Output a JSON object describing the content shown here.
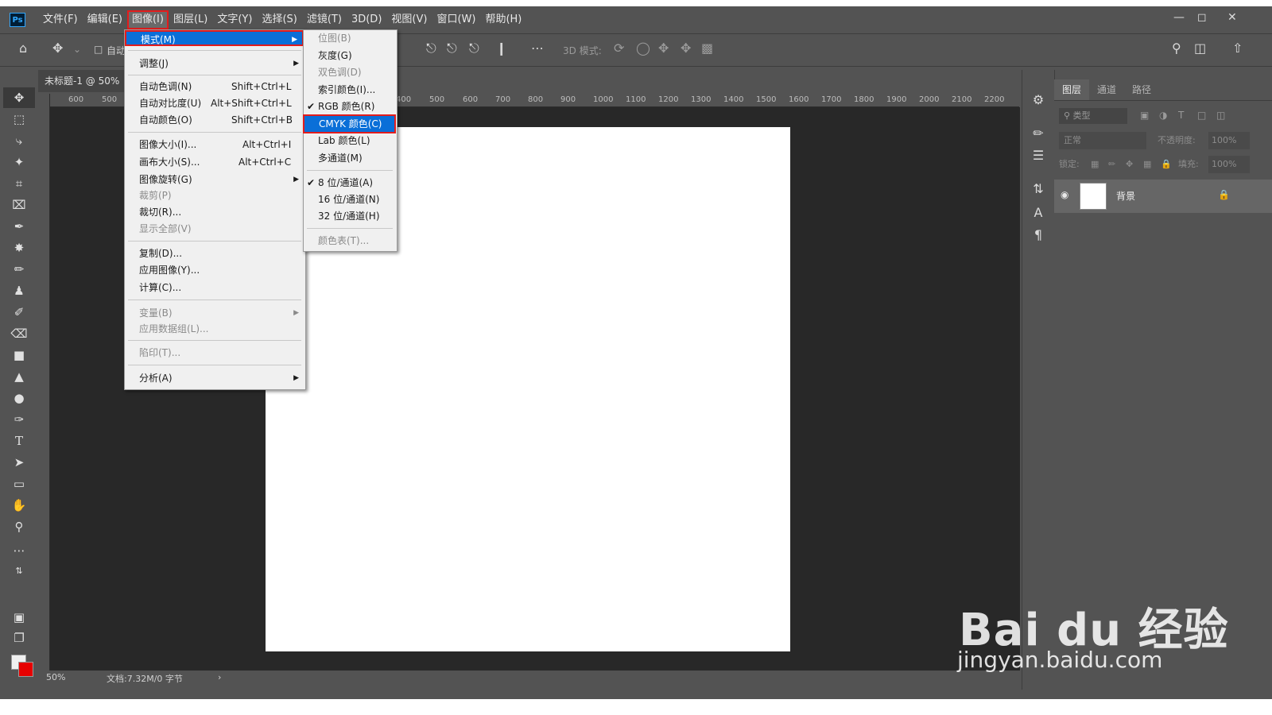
{
  "app": {
    "logo": "Ps",
    "menubar": [
      "文件(F)",
      "编辑(E)",
      "图像(I)",
      "图层(L)",
      "文字(Y)",
      "选择(S)",
      "滤镜(T)",
      "3D(D)",
      "视图(V)",
      "窗口(W)",
      "帮助(H)"
    ],
    "active_menu": "图像(I)"
  },
  "options_bar": {
    "auto_label": "自动",
    "mode_3d_label": "3D 模式:"
  },
  "document": {
    "tab_title": "未标题-1 @ 50%",
    "zoom": "50%",
    "status": "文档:7.32M/0 字节",
    "ruler_marks": [
      "600",
      "500",
      "400",
      "500",
      "600",
      "700",
      "800",
      "900",
      "1000",
      "1100",
      "1200",
      "1300",
      "1400",
      "1500",
      "1600",
      "1700",
      "1800",
      "1900",
      "2000",
      "2100",
      "2200"
    ]
  },
  "image_menu": {
    "items": [
      {
        "label": "模式(M)",
        "shortcut": "",
        "submenu": true,
        "highlighted": true
      },
      {
        "label": "调整(J)",
        "shortcut": "",
        "submenu": true
      },
      {
        "label": "自动色调(N)",
        "shortcut": "Shift+Ctrl+L"
      },
      {
        "label": "自动对比度(U)",
        "shortcut": "Alt+Shift+Ctrl+L"
      },
      {
        "label": "自动颜色(O)",
        "shortcut": "Shift+Ctrl+B"
      },
      {
        "label": "图像大小(I)...",
        "shortcut": "Alt+Ctrl+I"
      },
      {
        "label": "画布大小(S)...",
        "shortcut": "Alt+Ctrl+C"
      },
      {
        "label": "图像旋转(G)",
        "shortcut": "",
        "submenu": true
      },
      {
        "label": "裁剪(P)",
        "shortcut": "",
        "disabled": true
      },
      {
        "label": "裁切(R)...",
        "shortcut": ""
      },
      {
        "label": "显示全部(V)",
        "shortcut": "",
        "disabled": true
      },
      {
        "label": "复制(D)...",
        "shortcut": ""
      },
      {
        "label": "应用图像(Y)...",
        "shortcut": ""
      },
      {
        "label": "计算(C)...",
        "shortcut": ""
      },
      {
        "label": "变量(B)",
        "shortcut": "",
        "submenu": true,
        "disabled": true
      },
      {
        "label": "应用数据组(L)...",
        "shortcut": "",
        "disabled": true
      },
      {
        "label": "陷印(T)...",
        "shortcut": "",
        "disabled": true
      },
      {
        "label": "分析(A)",
        "shortcut": "",
        "submenu": true
      }
    ]
  },
  "mode_submenu": {
    "items": [
      {
        "label": "位图(B)",
        "disabled": true
      },
      {
        "label": "灰度(G)"
      },
      {
        "label": "双色调(D)",
        "disabled": true
      },
      {
        "label": "索引颜色(I)..."
      },
      {
        "label": "RGB 颜色(R)",
        "checked": true
      },
      {
        "label": "CMYK 颜色(C)",
        "highlighted": true
      },
      {
        "label": "Lab 颜色(L)"
      },
      {
        "label": "多通道(M)"
      },
      {
        "label": "8 位/通道(A)",
        "checked": true
      },
      {
        "label": "16 位/通道(N)"
      },
      {
        "label": "32 位/通道(H)"
      },
      {
        "label": "颜色表(T)...",
        "disabled": true
      }
    ]
  },
  "layers_panel": {
    "tabs": [
      "图层",
      "通道",
      "路径"
    ],
    "filter_placeholder": "类型",
    "blend_mode": "正常",
    "opacity_label": "不透明度:",
    "opacity_value": "100%",
    "lock_label": "锁定:",
    "fill_label": "填充:",
    "fill_value": "100%",
    "layer_name": "背景"
  },
  "watermark": {
    "logo_text": "Bai du 经验",
    "url": "jingyan.baidu.com"
  },
  "colors": {
    "ui_bg": "#535353",
    "workspace": "#282828",
    "highlight": "#0a6fd8",
    "annotation_red": "#e31c1c",
    "foreground": "#f0f0f0",
    "background_swatch": "#e60000"
  }
}
